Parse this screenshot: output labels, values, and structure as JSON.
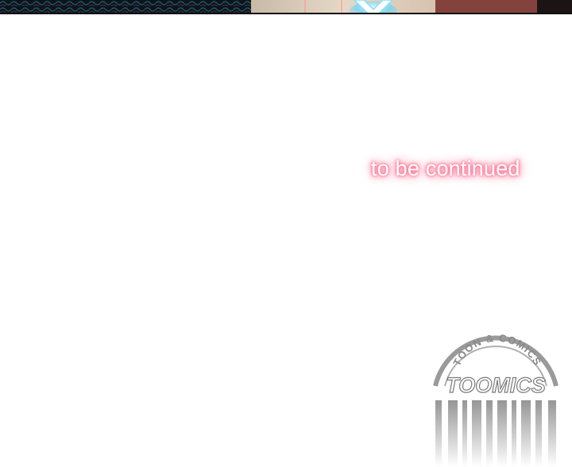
{
  "ending": {
    "text": "to be continued",
    "glow_color": "#ff6b8c"
  },
  "stamp": {
    "arc_text": "TOON & COMICS",
    "brand_text": "TOOMICS",
    "color": "#8a8a8a"
  }
}
